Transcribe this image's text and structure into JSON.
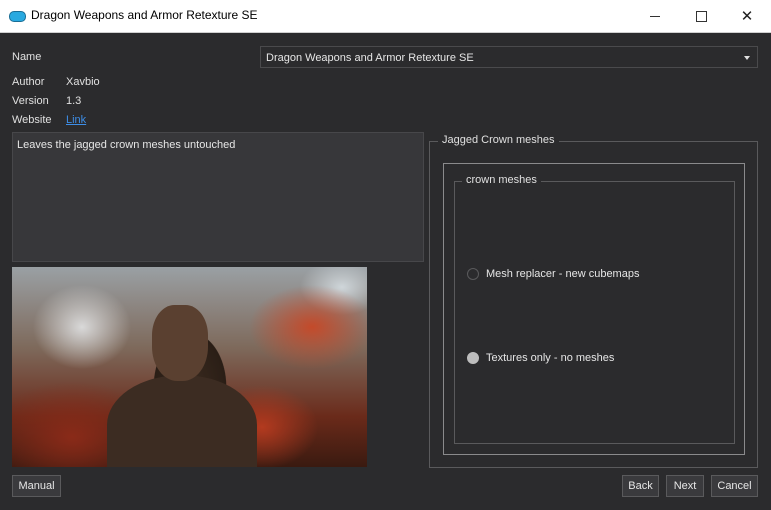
{
  "window": {
    "title": "Dragon Weapons and Armor Retexture SE",
    "minimize": "—",
    "maximize": "□",
    "close": "✕"
  },
  "info": {
    "name_label": "Name",
    "author_label": "Author",
    "author_value": "Xavbio",
    "version_label": "Version",
    "version_value": "1.3",
    "website_label": "Website",
    "website_link": "Link"
  },
  "selector": {
    "selected": "Dragon Weapons and Armor Retexture SE"
  },
  "description": "Leaves the jagged crown meshes untouched",
  "preview": {
    "icon": "armored-character-image"
  },
  "options": {
    "group_title": "Jagged Crown meshes",
    "subgroup_title": "crown meshes",
    "choices": [
      {
        "label": "Mesh replacer - new cubemaps",
        "selected": false
      },
      {
        "label": "Textures only - no meshes",
        "selected": true
      }
    ]
  },
  "buttons": {
    "manual": "Manual",
    "back": "Back",
    "next": "Next",
    "cancel": "Cancel"
  }
}
